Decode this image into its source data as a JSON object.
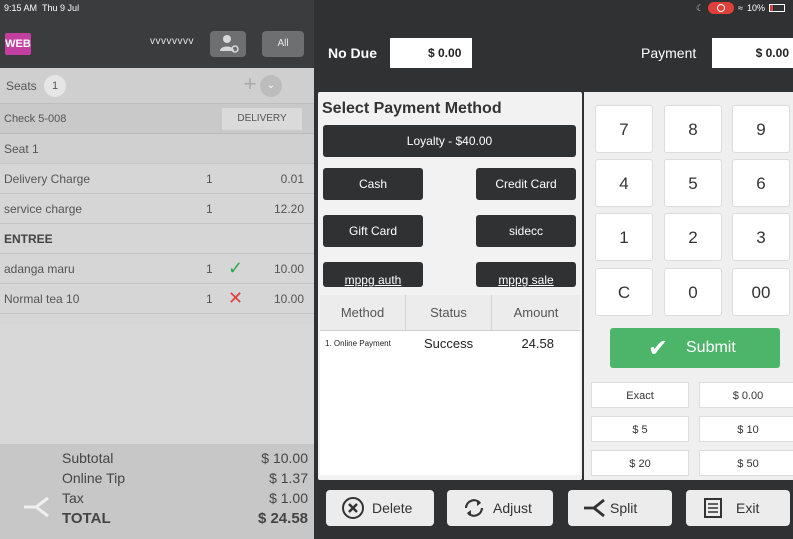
{
  "status": {
    "time": "9:15 AM",
    "date": "Thu 9 Jul",
    "battery": "10%"
  },
  "header_left": {
    "badge": "WEB",
    "user": "vvvvvvvv",
    "all_label": "All"
  },
  "seats": {
    "label": "Seats",
    "count": "1"
  },
  "check": {
    "number": "Check 5-008",
    "type": "DELIVERY"
  },
  "items": [
    {
      "name": "Seat 1",
      "kind": "header"
    },
    {
      "name": "Delivery Charge",
      "qty": "1",
      "price": "0.01"
    },
    {
      "name": "service charge",
      "qty": "1",
      "price": "12.20"
    },
    {
      "name": "ENTREE",
      "kind": "section"
    },
    {
      "name": "adanga maru",
      "qty": "1",
      "mark": "check",
      "price": "10.00"
    },
    {
      "name": "Normal tea 10",
      "qty": "1",
      "mark": "cross",
      "price": "10.00"
    }
  ],
  "totals": {
    "subtotal_label": "Subtotal",
    "subtotal": "$ 10.00",
    "tip_label": "Online Tip",
    "tip": "$ 1.37",
    "tax_label": "Tax",
    "tax": "$ 1.00",
    "total_label": "TOTAL",
    "total": "$ 24.58"
  },
  "top_right": {
    "no_due_label": "No Due",
    "no_due_value": "$ 0.00",
    "payment_label": "Payment",
    "payment_value": "$ 0.00"
  },
  "methods": {
    "title": "Select Payment Method",
    "loyalty": "Loyalty - $40.00",
    "cash": "Cash",
    "credit": "Credit Card",
    "gift": "Gift Card",
    "sidecc": "sidecc",
    "mppg_auth": "mppg auth",
    "mppg_sale": "mppg sale"
  },
  "payments_table": {
    "headers": [
      "Method",
      "Status",
      "Amount"
    ],
    "rows": [
      {
        "method": "1. Online Payment",
        "status": "Success",
        "amount": "24.58"
      }
    ]
  },
  "keypad": {
    "keys": [
      "7",
      "8",
      "9",
      "4",
      "5",
      "6",
      "1",
      "2",
      "3",
      "C",
      "0",
      "00"
    ],
    "submit": "Submit",
    "quick": [
      "Exact",
      "$ 0.00",
      "$ 5",
      "$ 10",
      "$ 20",
      "$ 50"
    ]
  },
  "bottom_bar": {
    "delete": "Delete",
    "adjust": "Adjust",
    "split": "Split",
    "exit": "Exit"
  },
  "colors": {
    "accent_green": "#4cb56a",
    "web_badge": "#c23fa0",
    "dark_bg": "#2f3133",
    "check_green": "#2aa84a",
    "cross_red": "#e0403a"
  }
}
